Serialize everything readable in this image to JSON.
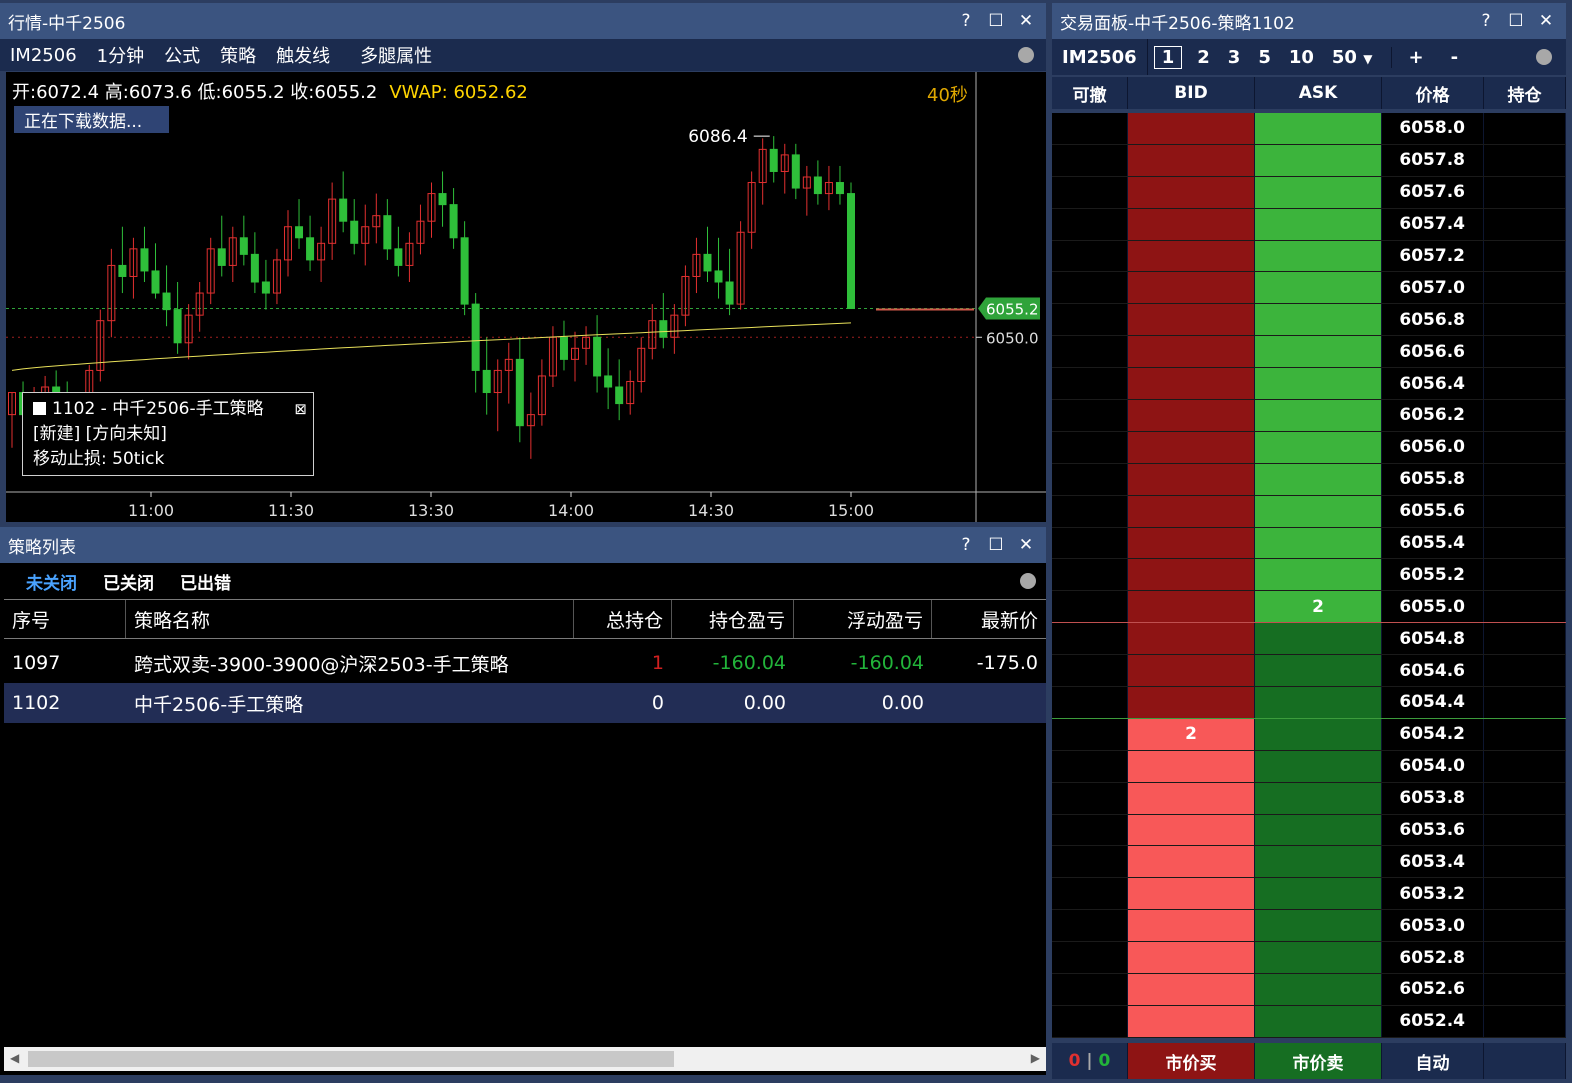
{
  "quote_window": {
    "title": "行情-中千2506",
    "controls": [
      "?",
      "☐",
      "✕"
    ],
    "toolbar": [
      "IM2506",
      "1分钟",
      "公式",
      "策略",
      "触发线",
      "多腿属性"
    ],
    "ohlc_text": "开:6072.4 高:6073.6 低:6055.2 收:6055.2",
    "vwap_text": "VWAP: 6052.62",
    "countdown": "40秒",
    "loading_text": "正在下载数据...",
    "info_box": {
      "line1": "1102 - 中千2506-手工策略",
      "line2": "[新建] [方向未知]",
      "line3": "移动止损: 50tick"
    }
  },
  "chart_data": {
    "type": "candlestick",
    "x_ticks": [
      "11:00",
      "11:30",
      "13:30",
      "14:00",
      "14:30",
      "15:00"
    ],
    "high_annotation": "6086.4",
    "last_price_label": "6055.2",
    "ref_price_label": "6050.0",
    "ylim": [
      6022,
      6098
    ],
    "last_price": 6055.2,
    "ref_price": 6050.0,
    "vwap_start": 6044.0,
    "vwap_end": 6052.6,
    "bars": [
      [
        6036,
        6040,
        6030,
        6040
      ],
      [
        6040,
        6042,
        6034,
        6036
      ],
      [
        6036,
        6041,
        6033,
        6039
      ],
      [
        6039,
        6043,
        6036,
        6041
      ],
      [
        6041,
        6044,
        6035,
        6038
      ],
      [
        6038,
        6042,
        6032,
        6034
      ],
      [
        6034,
        6040,
        6031,
        6037
      ],
      [
        6037,
        6045,
        6035,
        6044
      ],
      [
        6044,
        6055,
        6042,
        6053
      ],
      [
        6053,
        6066,
        6050,
        6063
      ],
      [
        6063,
        6070,
        6058,
        6061
      ],
      [
        6061,
        6068,
        6057,
        6066
      ],
      [
        6066,
        6070,
        6060,
        6062
      ],
      [
        6062,
        6067,
        6057,
        6058
      ],
      [
        6058,
        6063,
        6052,
        6055
      ],
      [
        6055,
        6060,
        6047,
        6049
      ],
      [
        6049,
        6056,
        6046,
        6054
      ],
      [
        6054,
        6060,
        6051,
        6058
      ],
      [
        6058,
        6068,
        6056,
        6066
      ],
      [
        6066,
        6072,
        6061,
        6063
      ],
      [
        6063,
        6070,
        6060,
        6068
      ],
      [
        6068,
        6072,
        6063,
        6065
      ],
      [
        6065,
        6069,
        6058,
        6060
      ],
      [
        6060,
        6064,
        6055,
        6058
      ],
      [
        6058,
        6066,
        6056,
        6064
      ],
      [
        6064,
        6073,
        6061,
        6070
      ],
      [
        6070,
        6075,
        6066,
        6068
      ],
      [
        6068,
        6072,
        6062,
        6064
      ],
      [
        6064,
        6070,
        6060,
        6067
      ],
      [
        6067,
        6078,
        6064,
        6075
      ],
      [
        6075,
        6080,
        6069,
        6071
      ],
      [
        6071,
        6075,
        6065,
        6067
      ],
      [
        6067,
        6074,
        6063,
        6070
      ],
      [
        6070,
        6076,
        6067,
        6072
      ],
      [
        6072,
        6075,
        6064,
        6066
      ],
      [
        6066,
        6070,
        6061,
        6063
      ],
      [
        6063,
        6069,
        6060,
        6067
      ],
      [
        6067,
        6074,
        6065,
        6071
      ],
      [
        6071,
        6078,
        6068,
        6076
      ],
      [
        6076,
        6080,
        6070,
        6074
      ],
      [
        6074,
        6077,
        6066,
        6068
      ],
      [
        6068,
        6071,
        6054,
        6056
      ],
      [
        6056,
        6058,
        6040,
        6044
      ],
      [
        6044,
        6050,
        6036,
        6040
      ],
      [
        6040,
        6046,
        6033,
        6044
      ],
      [
        6044,
        6049,
        6038,
        6046
      ],
      [
        6046,
        6050,
        6031,
        6034
      ],
      [
        6034,
        6040,
        6028,
        6036
      ],
      [
        6036,
        6046,
        6034,
        6043
      ],
      [
        6043,
        6052,
        6041,
        6050
      ],
      [
        6050,
        6053,
        6044,
        6046
      ],
      [
        6046,
        6051,
        6042,
        6048
      ],
      [
        6048,
        6052,
        6045,
        6050
      ],
      [
        6050,
        6054,
        6040,
        6043
      ],
      [
        6043,
        6048,
        6037,
        6041
      ],
      [
        6041,
        6046,
        6035,
        6038
      ],
      [
        6038,
        6044,
        6036,
        6042
      ],
      [
        6042,
        6050,
        6040,
        6048
      ],
      [
        6048,
        6056,
        6046,
        6053
      ],
      [
        6053,
        6058,
        6048,
        6050
      ],
      [
        6050,
        6056,
        6047,
        6054
      ],
      [
        6054,
        6063,
        6052,
        6061
      ],
      [
        6061,
        6068,
        6058,
        6065
      ],
      [
        6065,
        6070,
        6060,
        6062
      ],
      [
        6062,
        6068,
        6057,
        6060
      ],
      [
        6060,
        6066,
        6054,
        6056
      ],
      [
        6056,
        6071,
        6055,
        6069
      ],
      [
        6069,
        6080,
        6066,
        6078
      ],
      [
        6078,
        6086,
        6074,
        6084
      ],
      [
        6084,
        6086.4,
        6078,
        6080
      ],
      [
        6080,
        6085,
        6076,
        6083
      ],
      [
        6083,
        6085,
        6075,
        6077
      ],
      [
        6077,
        6081,
        6072,
        6079
      ],
      [
        6079,
        6082,
        6074,
        6076
      ],
      [
        6076,
        6081,
        6073,
        6078
      ],
      [
        6078,
        6081,
        6074,
        6076
      ],
      [
        6076,
        6078,
        6055.2,
        6055.2
      ]
    ]
  },
  "strategy_window": {
    "title": "策略列表",
    "controls": [
      "?",
      "☐",
      "✕"
    ],
    "tabs": [
      "未关闭",
      "已关闭",
      "已出错"
    ],
    "columns": [
      "序号",
      "策略名称",
      "总持仓",
      "持仓盈亏",
      "浮动盈亏",
      "最新价"
    ],
    "rows": [
      {
        "id": "1097",
        "name": "跨式双卖-3900-3900@沪深2503-手工策略",
        "pos": "1",
        "pos_pnl": "-160.04",
        "float_pnl": "-160.04",
        "last": "-175.0"
      },
      {
        "id": "1102",
        "name": "中千2506-手工策略",
        "pos": "0",
        "pos_pnl": "0.00",
        "float_pnl": "0.00",
        "last": ""
      }
    ]
  },
  "trade_window": {
    "title": "交易面板-中千2506-策略1102",
    "controls": [
      "?",
      "☐",
      "✕"
    ],
    "symbol": "IM2506",
    "qty_options": [
      "1",
      "2",
      "3",
      "5",
      "10",
      "50"
    ],
    "qty_selected": "1",
    "plus": "+",
    "minus": "-",
    "headers": [
      "可撤",
      "BID",
      "ASK",
      "价格",
      "持仓"
    ],
    "prices": [
      "6058.0",
      "6057.8",
      "6057.6",
      "6057.4",
      "6057.2",
      "6057.0",
      "6056.8",
      "6056.6",
      "6056.4",
      "6056.2",
      "6056.0",
      "6055.8",
      "6055.6",
      "6055.4",
      "6055.2",
      "6055.0",
      "6054.8",
      "6054.6",
      "6054.4",
      "6054.2",
      "6054.0",
      "6053.8",
      "6053.6",
      "6053.4",
      "6053.2",
      "6053.0",
      "6052.8",
      "6052.6",
      "6052.4"
    ],
    "ask_qty_at_6055_0": "2",
    "bid_qty_at_6054_2": "2",
    "footer": {
      "left_a": "0",
      "sep": "|",
      "left_b": "0",
      "buy": "市价买",
      "sell": "市价卖",
      "auto": "自动"
    },
    "colors": {
      "bid_dark": "#8e1414",
      "bid_light": "#f85858",
      "ask_light": "#3cb43c",
      "ask_dark": "#166e22"
    }
  }
}
